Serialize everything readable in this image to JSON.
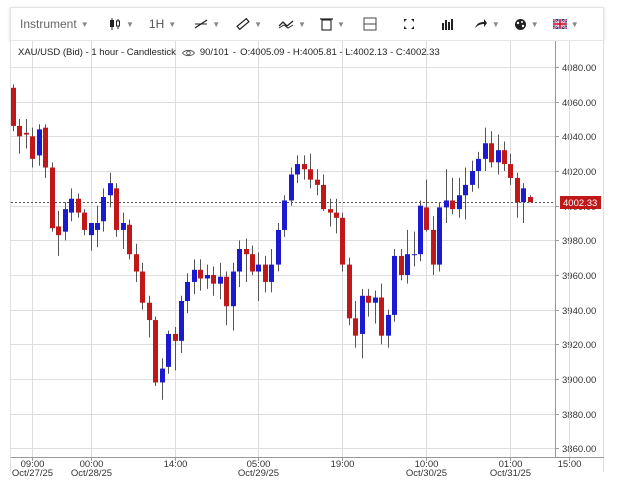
{
  "toolbar": {
    "instrument_label": "Instrument",
    "timeframe_label": "1H",
    "icons": [
      "candles-type-icon",
      "draw-line-icon",
      "ruler-icon",
      "indicators-icon",
      "trash-icon",
      "layout-icon",
      "fullscreen-icon",
      "volume-bars-icon",
      "trade-arrow-icon",
      "settings-palette-icon",
      "uk-flag-icon"
    ]
  },
  "info": {
    "symbol": "XAU/USD (Bid) - 1 hour - Candlestick",
    "counter": "90/101",
    "ohlc": "O:4005.09 - H:4005.81 - L:4002.13 - C:4002.33"
  },
  "price_badge": "4002.33",
  "colors": {
    "up": "#1a1ad0",
    "down": "#c01818",
    "badge": "#c01818",
    "grid": "#dddddd"
  },
  "chart_data": {
    "type": "candlestick",
    "title": "",
    "ylim": [
      3855,
      4095
    ],
    "y_ticks": [
      3860,
      3880,
      3900,
      3920,
      3940,
      3960,
      3980,
      4000,
      4020,
      4040,
      4060,
      4080
    ],
    "y_tick_labels": [
      "3860.00",
      "3880.00",
      "3900.00",
      "3920.00",
      "3940.00",
      "3960.00",
      "3980.00",
      "4000.00",
      "4020.00",
      "4040.00",
      "4060.00",
      "4080.00"
    ],
    "last_price": 4002.33,
    "x_ticks": [
      {
        "i": 3,
        "top": "09:00",
        "bottom": "Oct/27/25"
      },
      {
        "i": 12,
        "top": "00:00",
        "bottom": "Oct/28/25"
      },
      {
        "i": 25,
        "top": "14:00",
        "bottom": ""
      },
      {
        "i": 38,
        "top": "05:00",
        "bottom": "Oct/29/25"
      },
      {
        "i": 51,
        "top": "19:00",
        "bottom": ""
      },
      {
        "i": 64,
        "top": "10:00",
        "bottom": "Oct/30/25"
      },
      {
        "i": 77,
        "top": "01:00",
        "bottom": "Oct/31/25"
      },
      {
        "i": 86,
        "top": "15:00",
        "bottom": ""
      }
    ],
    "candles": [
      [
        4068,
        4070,
        4043,
        4046
      ],
      [
        4046,
        4050,
        4030,
        4040
      ],
      [
        4042,
        4050,
        4033,
        4041
      ],
      [
        4040,
        4045,
        4022,
        4027
      ],
      [
        4029,
        4047,
        4023,
        4044
      ],
      [
        4045,
        4047,
        4016,
        4022
      ],
      [
        4022,
        4025,
        3985,
        3987
      ],
      [
        3988,
        3997,
        3971,
        3983
      ],
      [
        3985,
        4002,
        3980,
        3998
      ],
      [
        3996,
        4010,
        3991,
        4004
      ],
      [
        4004,
        4007,
        3993,
        3996
      ],
      [
        3996,
        3998,
        3983,
        3986
      ],
      [
        3983,
        3990,
        3974,
        3990
      ],
      [
        3986,
        4000,
        3976,
        3990
      ],
      [
        3991,
        4010,
        3985,
        4005
      ],
      [
        4006,
        4019,
        3999,
        4013
      ],
      [
        4010,
        4013,
        3982,
        3986
      ],
      [
        3986,
        3996,
        3975,
        3990
      ],
      [
        3989,
        3992,
        3969,
        3972
      ],
      [
        3972,
        3978,
        3956,
        3962
      ],
      [
        3962,
        3967,
        3940,
        3944
      ],
      [
        3944,
        3948,
        3924,
        3934
      ],
      [
        3934,
        3936,
        3896,
        3898
      ],
      [
        3898,
        3912,
        3888,
        3906
      ],
      [
        3907,
        3928,
        3903,
        3926
      ],
      [
        3926,
        3930,
        3905,
        3922
      ],
      [
        3922,
        3948,
        3915,
        3945
      ],
      [
        3945,
        3961,
        3938,
        3956
      ],
      [
        3956,
        3969,
        3949,
        3963
      ],
      [
        3963,
        3969,
        3951,
        3958
      ],
      [
        3958,
        3966,
        3952,
        3960
      ],
      [
        3960,
        3965,
        3948,
        3955
      ],
      [
        3955,
        3967,
        3946,
        3959
      ],
      [
        3959,
        3962,
        3931,
        3942
      ],
      [
        3942,
        3967,
        3928,
        3962
      ],
      [
        3962,
        3980,
        3953,
        3975
      ],
      [
        3975,
        3981,
        3956,
        3972
      ],
      [
        3972,
        3977,
        3960,
        3962
      ],
      [
        3962,
        3973,
        3945,
        3966
      ],
      [
        3966,
        3971,
        3950,
        3956
      ],
      [
        3956,
        3975,
        3950,
        3966
      ],
      [
        3966,
        3990,
        3962,
        3986
      ],
      [
        3986,
        4006,
        3982,
        4003
      ],
      [
        4003,
        4022,
        4000,
        4018
      ],
      [
        4018,
        4029,
        4013,
        4024
      ],
      [
        4024,
        4029,
        4015,
        4021
      ],
      [
        4021,
        4030,
        4010,
        4015
      ],
      [
        4015,
        4021,
        4006,
        4012
      ],
      [
        4012,
        4018,
        3997,
        3998
      ],
      [
        3998,
        4004,
        3988,
        3996
      ],
      [
        3996,
        4004,
        3984,
        3993
      ],
      [
        3993,
        3996,
        3962,
        3966
      ],
      [
        3966,
        3970,
        3931,
        3935
      ],
      [
        3935,
        3945,
        3918,
        3925
      ],
      [
        3926,
        3952,
        3912,
        3948
      ],
      [
        3948,
        3952,
        3936,
        3944
      ],
      [
        3944,
        3951,
        3932,
        3947
      ],
      [
        3947,
        3955,
        3920,
        3925
      ],
      [
        3925,
        3940,
        3918,
        3937
      ],
      [
        3937,
        3975,
        3933,
        3971
      ],
      [
        3971,
        3975,
        3957,
        3960
      ],
      [
        3960,
        3986,
        3955,
        3972
      ],
      [
        3972,
        3985,
        3965,
        3972
      ],
      [
        3972,
        4003,
        3968,
        4000
      ],
      [
        3999,
        4015,
        3985,
        3986
      ],
      [
        3986,
        3994,
        3960,
        3966
      ],
      [
        3966,
        4002,
        3962,
        3999
      ],
      [
        3999,
        4021,
        3990,
        4003
      ],
      [
        4003,
        4016,
        3995,
        3998
      ],
      [
        3998,
        4016,
        3993,
        4006
      ],
      [
        4006,
        4022,
        3992,
        4012
      ],
      [
        4012,
        4026,
        4008,
        4020
      ],
      [
        4020,
        4031,
        4010,
        4027
      ],
      [
        4027,
        4045,
        4020,
        4036
      ],
      [
        4036,
        4043,
        4022,
        4025
      ],
      [
        4025,
        4041,
        4018,
        4032
      ],
      [
        4032,
        4037,
        4020,
        4024
      ],
      [
        4024,
        4030,
        4012,
        4016
      ],
      [
        4016,
        4019,
        3993,
        4002
      ],
      [
        4002,
        4013,
        3990,
        4010
      ],
      [
        4005,
        4006,
        4002,
        4002
      ]
    ]
  }
}
